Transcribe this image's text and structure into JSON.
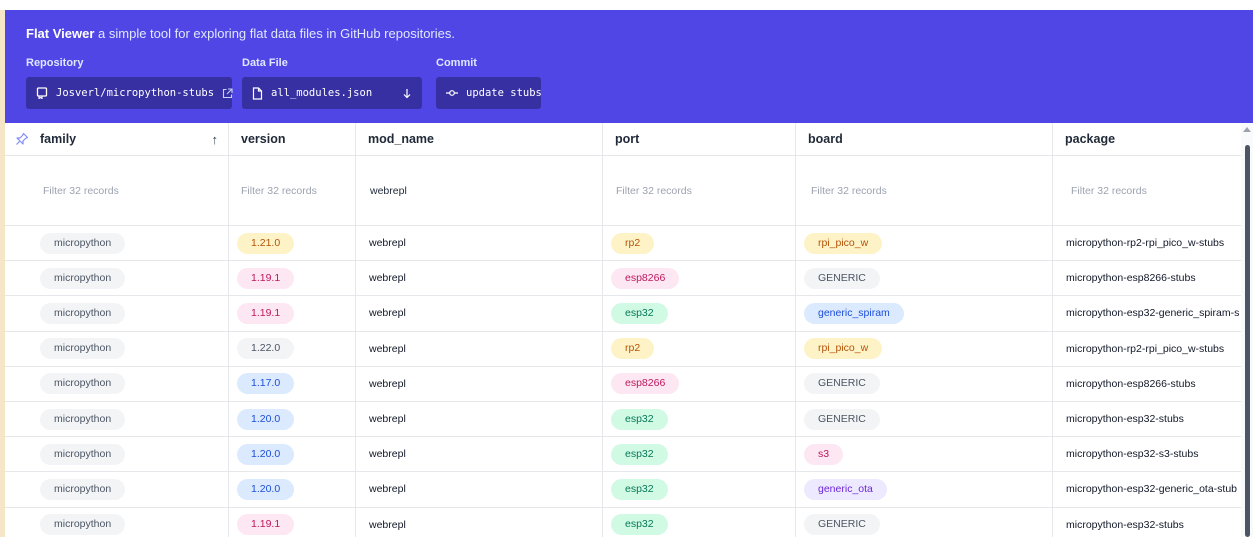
{
  "app": {
    "title": "Flat Viewer",
    "tagline": "a simple tool for exploring flat data files in GitHub repositories."
  },
  "header": {
    "repository_label": "Repository",
    "repository_value": "Josverl/micropython-stubs",
    "datafile_label": "Data File",
    "datafile_value": "all_modules.json",
    "commit_label": "Commit",
    "commit_value": "update stubs"
  },
  "table": {
    "columns": [
      "family",
      "version",
      "mod_name",
      "port",
      "board",
      "package"
    ],
    "sort": {
      "column": "family",
      "direction": "asc",
      "indicator": "↑"
    },
    "filters": {
      "placeholder": "Filter 32 records",
      "mod_name_value": "webrepl"
    },
    "rows": [
      {
        "family": "micropython",
        "version": "1.21.0",
        "mod_name": "webrepl",
        "port": "rp2",
        "board": "rpi_pico_w",
        "package": "micropython-rp2-rpi_pico_w-stubs"
      },
      {
        "family": "micropython",
        "version": "1.19.1",
        "mod_name": "webrepl",
        "port": "esp8266",
        "board": "GENERIC",
        "package": "micropython-esp8266-stubs"
      },
      {
        "family": "micropython",
        "version": "1.19.1",
        "mod_name": "webrepl",
        "port": "esp32",
        "board": "generic_spiram",
        "package": "micropython-esp32-generic_spiram-s"
      },
      {
        "family": "micropython",
        "version": "1.22.0",
        "mod_name": "webrepl",
        "port": "rp2",
        "board": "rpi_pico_w",
        "package": "micropython-rp2-rpi_pico_w-stubs"
      },
      {
        "family": "micropython",
        "version": "1.17.0",
        "mod_name": "webrepl",
        "port": "esp8266",
        "board": "GENERIC",
        "package": "micropython-esp8266-stubs"
      },
      {
        "family": "micropython",
        "version": "1.20.0",
        "mod_name": "webrepl",
        "port": "esp32",
        "board": "GENERIC",
        "package": "micropython-esp32-stubs"
      },
      {
        "family": "micropython",
        "version": "1.20.0",
        "mod_name": "webrepl",
        "port": "esp32",
        "board": "s3",
        "package": "micropython-esp32-s3-stubs"
      },
      {
        "family": "micropython",
        "version": "1.20.0",
        "mod_name": "webrepl",
        "port": "esp32",
        "board": "generic_ota",
        "package": "micropython-esp32-generic_ota-stub"
      },
      {
        "family": "micropython",
        "version": "1.19.1",
        "mod_name": "webrepl",
        "port": "esp32",
        "board": "GENERIC",
        "package": "micropython-esp32-stubs"
      }
    ]
  },
  "badge_colors": {
    "version": {
      "1.21.0": "yellow",
      "1.19.1": "pink",
      "1.22.0": "gray",
      "1.17.0": "blue",
      "1.20.0": "blue"
    },
    "port": {
      "rp2": "yellow",
      "esp8266": "pink",
      "esp32": "green"
    },
    "board": {
      "rpi_pico_w": "yellow",
      "GENERIC": "gray",
      "generic_spiram": "blue",
      "s3": "pink",
      "generic_ota": "purple"
    }
  },
  "colors": {
    "header_bg": "#4f46e5",
    "pill_bg": "#3730a3",
    "gray": "#f3f4f6",
    "yellow": "#fef3c7",
    "pink": "#fce7f3",
    "blue": "#dbeafe",
    "green": "#d1fae5",
    "purple": "#ede9fe"
  },
  "icons": {
    "repository": "repo-icon",
    "external_link": "external-link-icon",
    "data_file": "file-icon",
    "dropdown": "arrow-down-icon",
    "commit": "git-commit-icon",
    "pin": "pin-icon"
  }
}
